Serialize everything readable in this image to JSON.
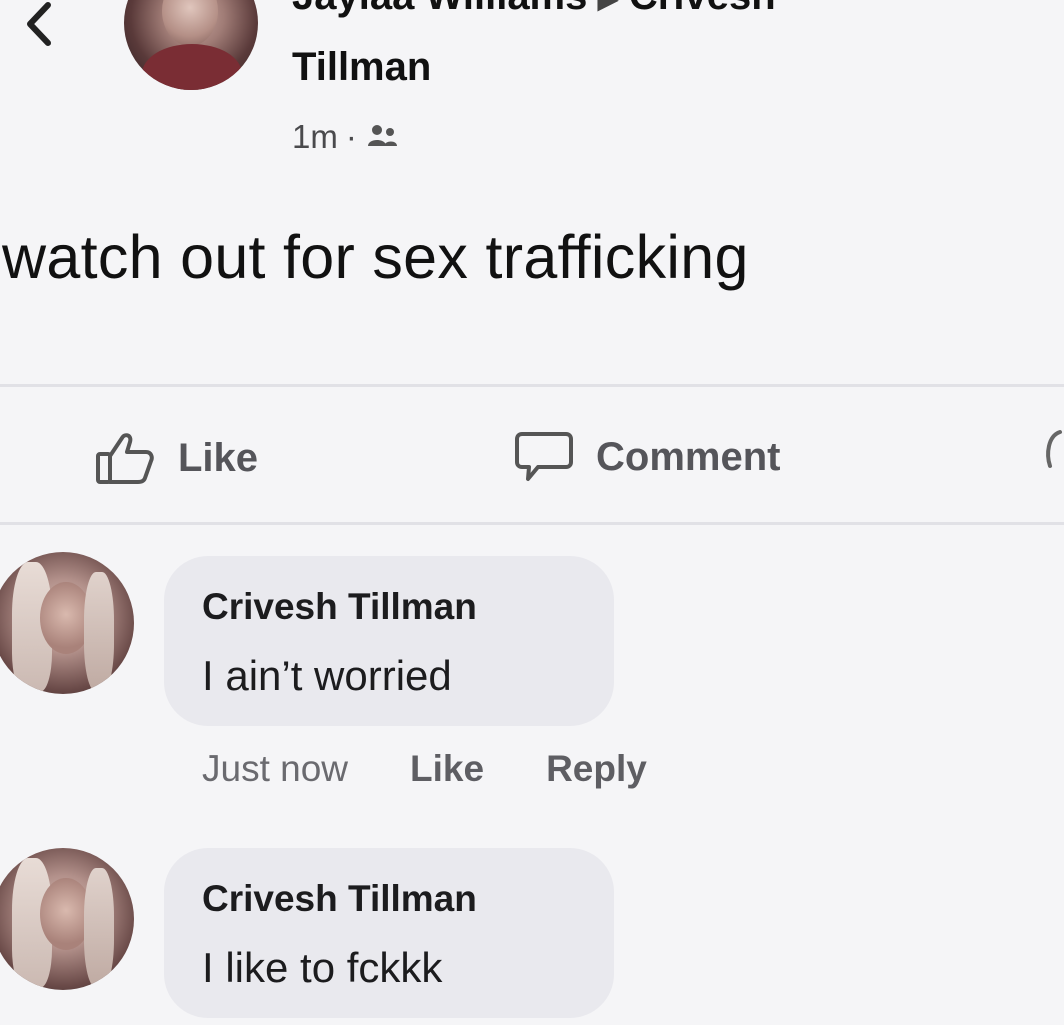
{
  "post": {
    "author": "Jaylaa Williams",
    "target_first": "Crivesh",
    "target_last": "Tillman",
    "time": "1m",
    "separator": "·",
    "audience_icon": "friends-icon",
    "text": "watch out for sex trafficking"
  },
  "actions": {
    "like_label": "Like",
    "comment_label": "Comment"
  },
  "comments": [
    {
      "name": "Crivesh Tillman",
      "text": "I ain’t worried",
      "time": "Just now",
      "like_label": "Like",
      "reply_label": "Reply"
    },
    {
      "name": "Crivesh Tillman",
      "text": "I like to fckkk"
    }
  ],
  "colors": {
    "background": "#f5f5f7",
    "bubble": "#e9e9ee",
    "text": "#1c1c1e",
    "muted": "#55555a"
  }
}
